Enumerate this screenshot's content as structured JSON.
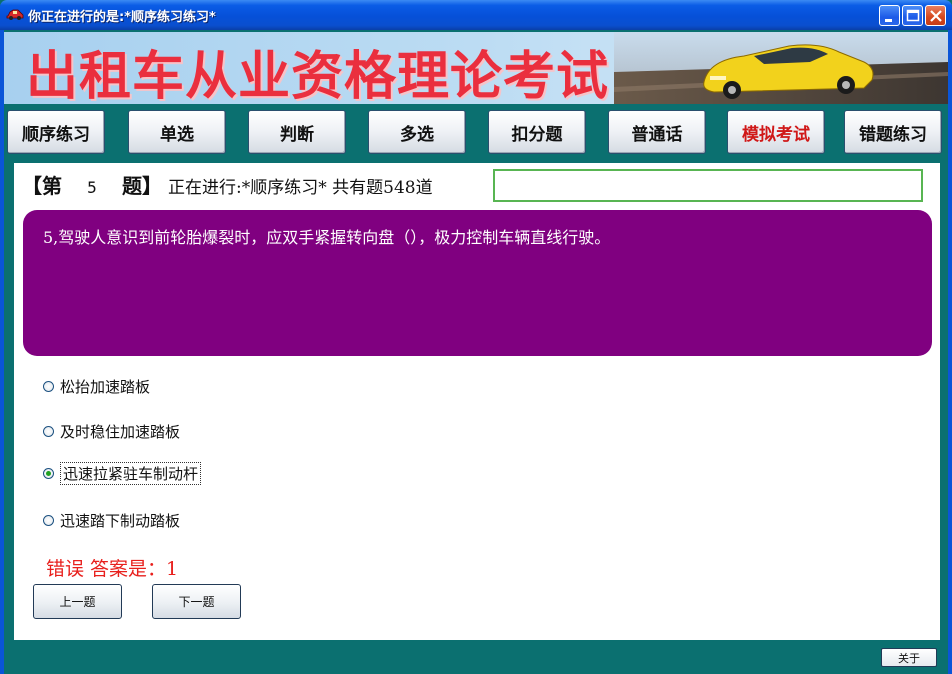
{
  "window": {
    "title": "你正在进行的是:*顺序练习练习*",
    "app_icon": "car-icon",
    "controls": [
      "minimize-icon",
      "maximize-icon",
      "close-icon"
    ]
  },
  "banner": {
    "title": "出租车从业资格理论考试",
    "image": "yellow-car-photo"
  },
  "nav": {
    "items": [
      {
        "label": "顺序练习"
      },
      {
        "label": "单选"
      },
      {
        "label": "判断"
      },
      {
        "label": "多选"
      },
      {
        "label": "扣分题"
      },
      {
        "label": "普通话"
      },
      {
        "label": "模拟考试",
        "active": true
      },
      {
        "label": "错题练习"
      }
    ]
  },
  "question_header": {
    "open_bracket": "【第",
    "number": "5",
    "close_bracket": "题】",
    "status": "正在进行:*顺序练习* 共有题548道",
    "answer_value": ""
  },
  "question": {
    "text": "5,驾驶人意识到前轮胎爆裂时，应双手紧握转向盘（），极力控制车辆直线行驶。"
  },
  "options": [
    {
      "label": "松抬加速踏板",
      "checked": false
    },
    {
      "label": "及时稳住加速踏板",
      "checked": false
    },
    {
      "label": "迅速拉紧驻车制动杆",
      "checked": true
    },
    {
      "label": "迅速踏下制动踏板",
      "checked": false
    }
  ],
  "result": {
    "text": "错误  答案是：1",
    "color": "#e8201d"
  },
  "buttons": {
    "prev": "上一题",
    "next": "下一题",
    "about": "关于"
  },
  "colors": {
    "titlebar": "#0a5ce6",
    "frame": "#0b7070",
    "question_box": "#800080",
    "active_nav": "#d01818",
    "banner_title": "#ea2f3e"
  }
}
